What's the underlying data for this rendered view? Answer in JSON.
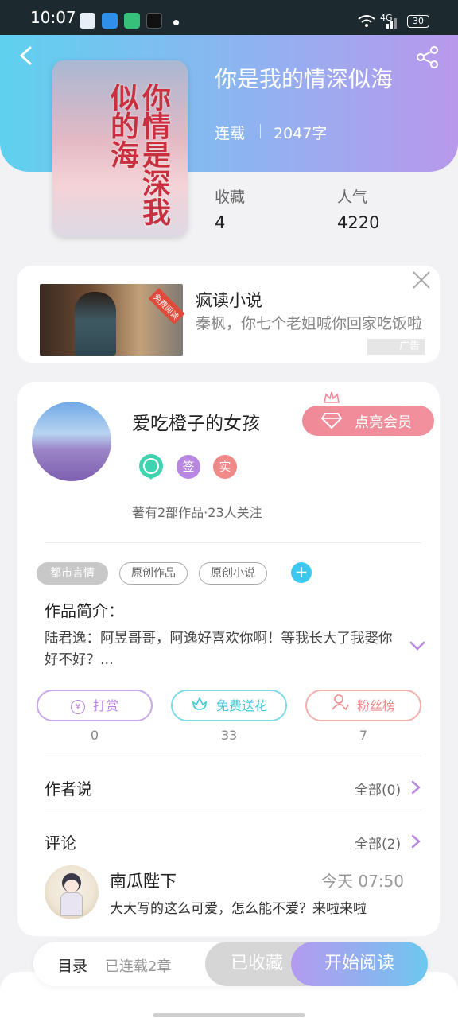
{
  "status_bar": {
    "time": "10:07",
    "network": "4G",
    "battery": "30"
  },
  "book": {
    "title": "你是我的情深似海",
    "cover_title": "你情是深我似的海",
    "status": "连载",
    "word_count": "2047字",
    "stats": [
      {
        "label": "收藏",
        "value": "4"
      },
      {
        "label": "人气",
        "value": "4220"
      }
    ]
  },
  "ad": {
    "tag": "免费阅读",
    "title": "疯读小说",
    "description": "秦枫，你七个老姐喊你回家吃饭啦",
    "badge": "广告"
  },
  "author": {
    "name": "爱吃橙子的女孩",
    "vip_button": "点亮会员",
    "badges": [
      "签",
      "实"
    ],
    "works_summary": "著有2部作品·23人关注"
  },
  "tags": [
    "都市言情",
    "原创作品",
    "原创小说"
  ],
  "intro": {
    "title": "作品简介：",
    "text": "陆君逸：阿昱哥哥，阿逸好喜欢你啊！等我长大了我娶你好不好？..."
  },
  "actions": [
    {
      "label": "打赏",
      "count": "0",
      "icon": "yen-coin-icon",
      "color": "#b887e0"
    },
    {
      "label": "免费送花",
      "count": "33",
      "icon": "flower-icon",
      "color": "#3ec8d6"
    },
    {
      "label": "粉丝榜",
      "count": "7",
      "icon": "fans-icon",
      "color": "#f08a88"
    }
  ],
  "author_says": {
    "title": "作者说",
    "more": "全部(0)"
  },
  "comments": {
    "title": "评论",
    "more": "全部(2)",
    "items": [
      {
        "name": "南瓜陛下",
        "time": "今天 07:50",
        "text": "大大写的这么可爱，怎么能不爱？来啦来啦"
      }
    ]
  },
  "bottom_bar": {
    "toc_label": "目录",
    "toc_sub": "已连载2章",
    "favorited": "已收藏",
    "start_reading": "开始阅读"
  },
  "colors": {
    "accent_purple": "#b887e0",
    "vip_pink": "#f08a99",
    "tag_add_blue": "#3ec8ef"
  }
}
